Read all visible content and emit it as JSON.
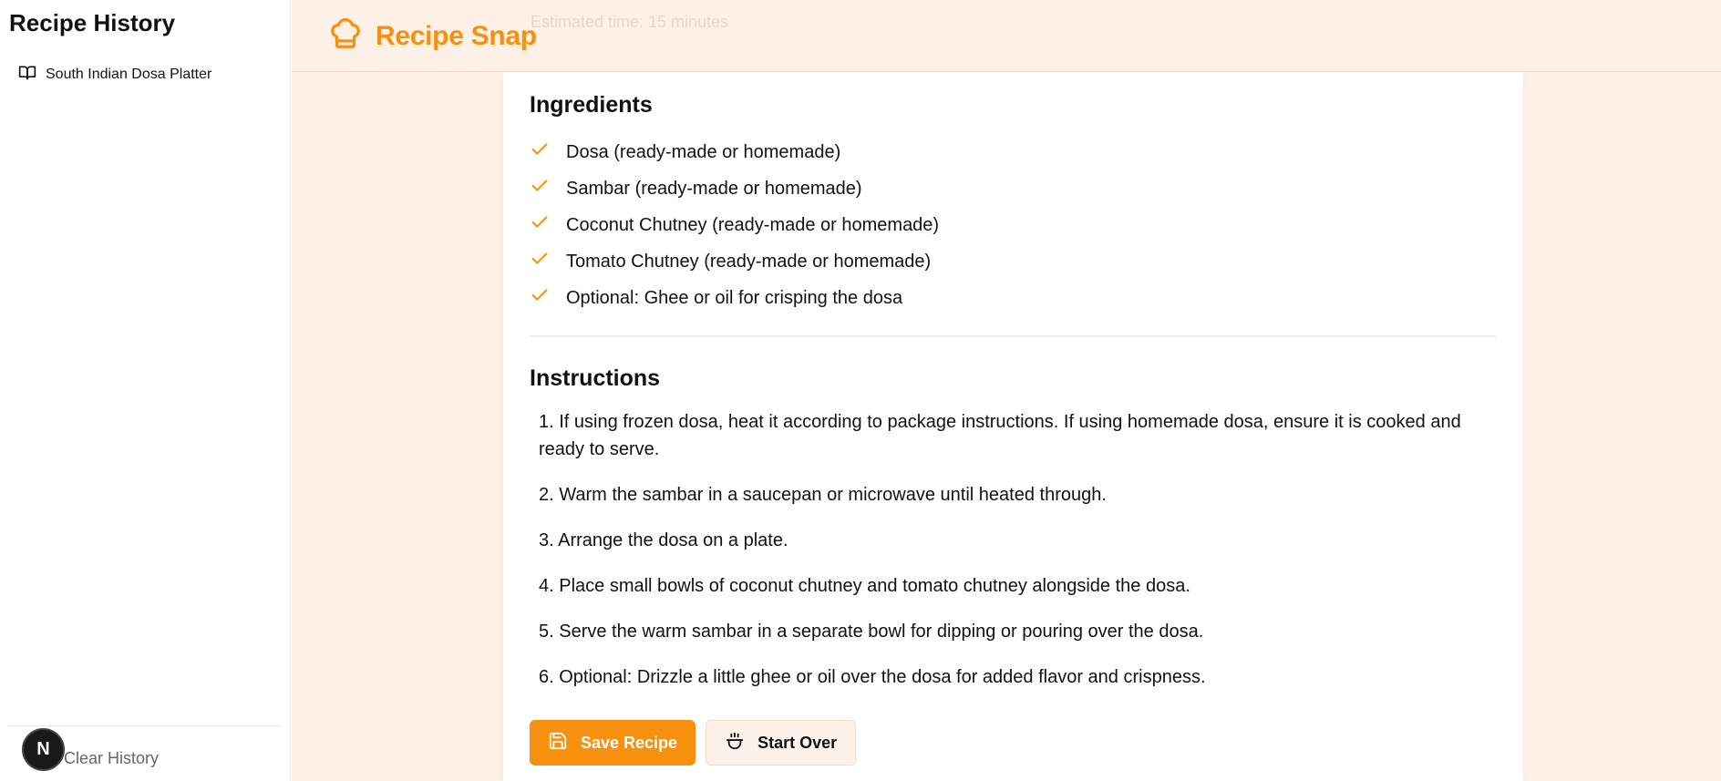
{
  "sidebar": {
    "title": "Recipe History",
    "items": [
      {
        "label": "South Indian Dosa Platter",
        "icon": "book-open-icon"
      }
    ],
    "clear_label": "Clear History",
    "badge_letter": "N"
  },
  "header": {
    "brand": "Recipe Snap",
    "brand_icon": "chef-hat-icon",
    "ghost_text": "Estimated time: 15 minutes"
  },
  "recipe": {
    "ingredients_title": "Ingredients",
    "ingredients": [
      "Dosa (ready-made or homemade)",
      "Sambar (ready-made or homemade)",
      "Coconut Chutney (ready-made or homemade)",
      "Tomato Chutney (ready-made or homemade)",
      "Optional: Ghee or oil for crisping the dosa"
    ],
    "instructions_title": "Instructions",
    "instructions": [
      "1. If using frozen dosa, heat it according to package instructions. If using homemade dosa, ensure it is cooked and ready to serve.",
      "2. Warm the sambar in a saucepan or microwave until heated through.",
      "3. Arrange the dosa on a plate.",
      "4. Place small bowls of coconut chutney and tomato chutney alongside the dosa.",
      "5. Serve the warm sambar in a separate bowl for dipping or pouring over the dosa.",
      "6. Optional: Drizzle a little ghee or oil over the dosa for added flavor and crispness."
    ],
    "save_label": "Save Recipe",
    "start_over_label": "Start Over"
  },
  "colors": {
    "accent": "#f7900f",
    "background": "#fdf0e6"
  }
}
